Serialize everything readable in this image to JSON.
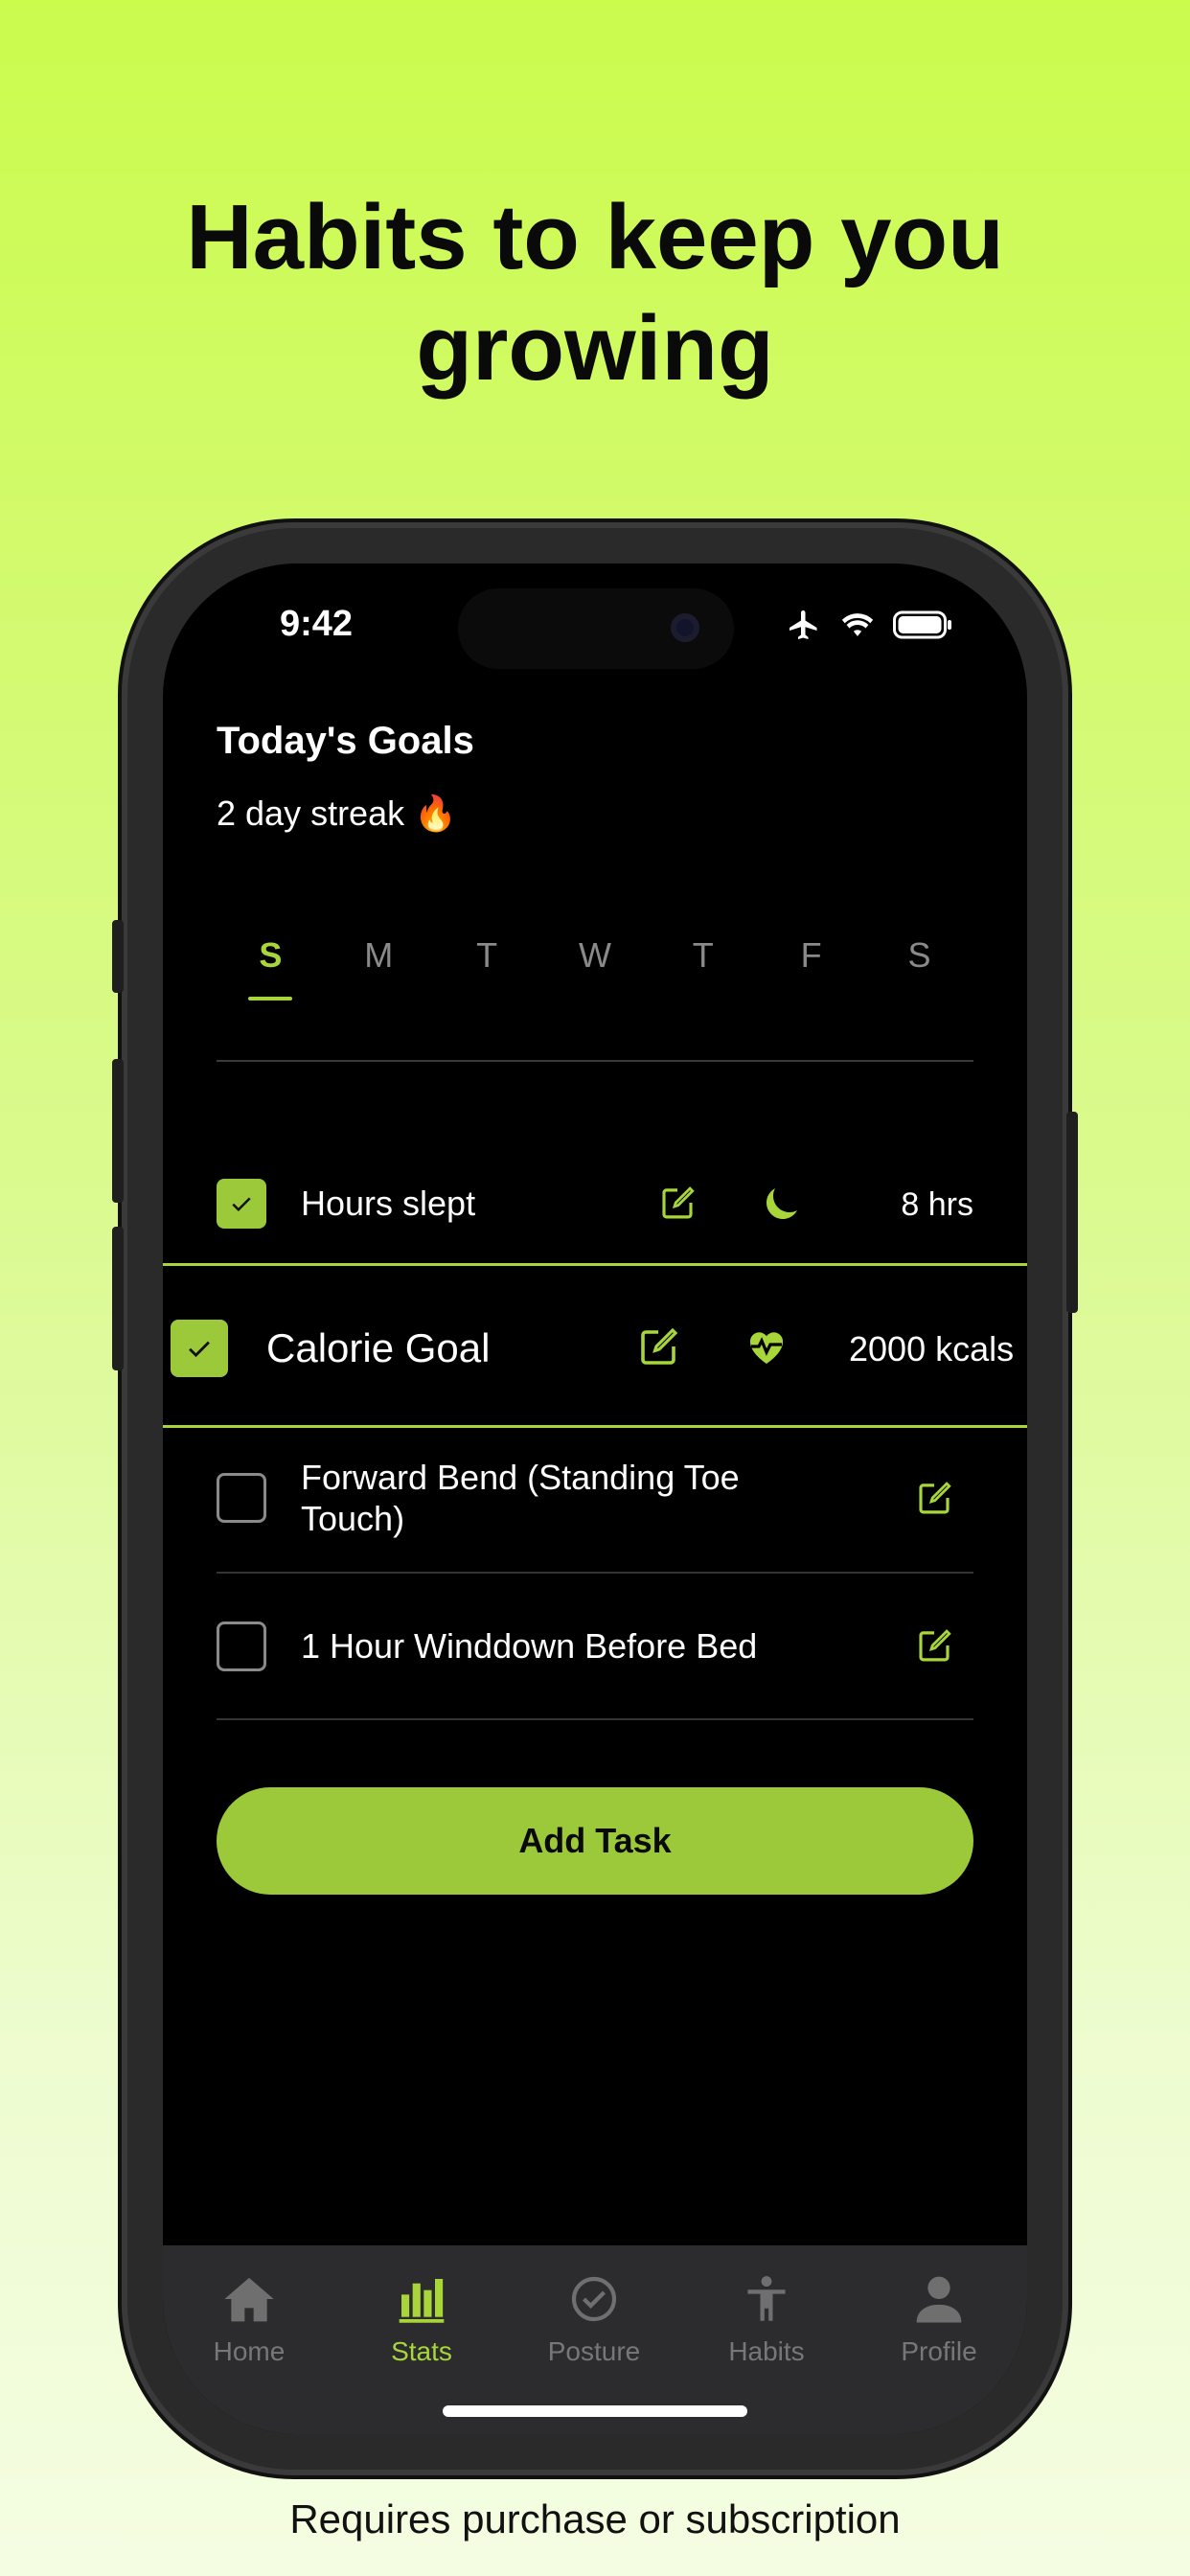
{
  "headline": {
    "line1": "Habits to keep you",
    "line2": "growing"
  },
  "footer_note": "Requires purchase or subscription",
  "status_bar": {
    "time": "9:42",
    "icons": [
      "airplane-icon",
      "wifi-icon",
      "battery-icon"
    ]
  },
  "screen": {
    "title": "Today's Goals",
    "streak": "2 day streak",
    "streak_emoji": "🔥",
    "days": [
      "S",
      "M",
      "T",
      "W",
      "T",
      "F",
      "S"
    ],
    "active_day_index": 0,
    "tasks": [
      {
        "label": "Hours slept",
        "checked": true,
        "icon": "moon-icon",
        "value": "8 hrs"
      },
      {
        "label": "Calorie Goal",
        "checked": true,
        "icon": "heart-pulse-icon",
        "value": "2000 kcals",
        "highlighted": true
      },
      {
        "label": "Forward Bend (Standing Toe Touch)",
        "checked": false
      },
      {
        "label": "1 Hour Winddown Before Bed",
        "checked": false
      }
    ],
    "add_button": "Add Task"
  },
  "tabbar": {
    "items": [
      {
        "label": "Home",
        "icon": "home-icon",
        "active": false
      },
      {
        "label": "Stats",
        "icon": "bar-chart-icon",
        "active": true
      },
      {
        "label": "Posture",
        "icon": "check-circle-icon",
        "active": false
      },
      {
        "label": "Habits",
        "icon": "person-icon",
        "active": false
      },
      {
        "label": "Profile",
        "icon": "profile-icon",
        "active": false
      }
    ]
  },
  "colors": {
    "accent": "#a7d53a",
    "button": "#9cc93a",
    "background_top": "#cbfb4d",
    "screen_bg": "#000000",
    "tabbar_bg": "#2c2c2e"
  }
}
